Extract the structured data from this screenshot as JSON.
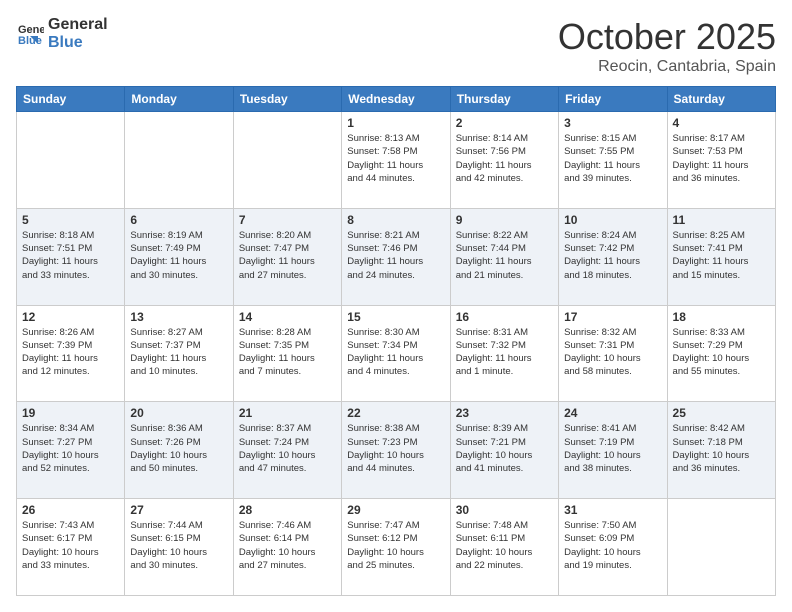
{
  "header": {
    "logo_general": "General",
    "logo_blue": "Blue",
    "month": "October 2025",
    "location": "Reocin, Cantabria, Spain"
  },
  "weekdays": [
    "Sunday",
    "Monday",
    "Tuesday",
    "Wednesday",
    "Thursday",
    "Friday",
    "Saturday"
  ],
  "weeks": [
    [
      {
        "day": "",
        "info": ""
      },
      {
        "day": "",
        "info": ""
      },
      {
        "day": "",
        "info": ""
      },
      {
        "day": "1",
        "info": "Sunrise: 8:13 AM\nSunset: 7:58 PM\nDaylight: 11 hours\nand 44 minutes."
      },
      {
        "day": "2",
        "info": "Sunrise: 8:14 AM\nSunset: 7:56 PM\nDaylight: 11 hours\nand 42 minutes."
      },
      {
        "day": "3",
        "info": "Sunrise: 8:15 AM\nSunset: 7:55 PM\nDaylight: 11 hours\nand 39 minutes."
      },
      {
        "day": "4",
        "info": "Sunrise: 8:17 AM\nSunset: 7:53 PM\nDaylight: 11 hours\nand 36 minutes."
      }
    ],
    [
      {
        "day": "5",
        "info": "Sunrise: 8:18 AM\nSunset: 7:51 PM\nDaylight: 11 hours\nand 33 minutes."
      },
      {
        "day": "6",
        "info": "Sunrise: 8:19 AM\nSunset: 7:49 PM\nDaylight: 11 hours\nand 30 minutes."
      },
      {
        "day": "7",
        "info": "Sunrise: 8:20 AM\nSunset: 7:47 PM\nDaylight: 11 hours\nand 27 minutes."
      },
      {
        "day": "8",
        "info": "Sunrise: 8:21 AM\nSunset: 7:46 PM\nDaylight: 11 hours\nand 24 minutes."
      },
      {
        "day": "9",
        "info": "Sunrise: 8:22 AM\nSunset: 7:44 PM\nDaylight: 11 hours\nand 21 minutes."
      },
      {
        "day": "10",
        "info": "Sunrise: 8:24 AM\nSunset: 7:42 PM\nDaylight: 11 hours\nand 18 minutes."
      },
      {
        "day": "11",
        "info": "Sunrise: 8:25 AM\nSunset: 7:41 PM\nDaylight: 11 hours\nand 15 minutes."
      }
    ],
    [
      {
        "day": "12",
        "info": "Sunrise: 8:26 AM\nSunset: 7:39 PM\nDaylight: 11 hours\nand 12 minutes."
      },
      {
        "day": "13",
        "info": "Sunrise: 8:27 AM\nSunset: 7:37 PM\nDaylight: 11 hours\nand 10 minutes."
      },
      {
        "day": "14",
        "info": "Sunrise: 8:28 AM\nSunset: 7:35 PM\nDaylight: 11 hours\nand 7 minutes."
      },
      {
        "day": "15",
        "info": "Sunrise: 8:30 AM\nSunset: 7:34 PM\nDaylight: 11 hours\nand 4 minutes."
      },
      {
        "day": "16",
        "info": "Sunrise: 8:31 AM\nSunset: 7:32 PM\nDaylight: 11 hours\nand 1 minute."
      },
      {
        "day": "17",
        "info": "Sunrise: 8:32 AM\nSunset: 7:31 PM\nDaylight: 10 hours\nand 58 minutes."
      },
      {
        "day": "18",
        "info": "Sunrise: 8:33 AM\nSunset: 7:29 PM\nDaylight: 10 hours\nand 55 minutes."
      }
    ],
    [
      {
        "day": "19",
        "info": "Sunrise: 8:34 AM\nSunset: 7:27 PM\nDaylight: 10 hours\nand 52 minutes."
      },
      {
        "day": "20",
        "info": "Sunrise: 8:36 AM\nSunset: 7:26 PM\nDaylight: 10 hours\nand 50 minutes."
      },
      {
        "day": "21",
        "info": "Sunrise: 8:37 AM\nSunset: 7:24 PM\nDaylight: 10 hours\nand 47 minutes."
      },
      {
        "day": "22",
        "info": "Sunrise: 8:38 AM\nSunset: 7:23 PM\nDaylight: 10 hours\nand 44 minutes."
      },
      {
        "day": "23",
        "info": "Sunrise: 8:39 AM\nSunset: 7:21 PM\nDaylight: 10 hours\nand 41 minutes."
      },
      {
        "day": "24",
        "info": "Sunrise: 8:41 AM\nSunset: 7:19 PM\nDaylight: 10 hours\nand 38 minutes."
      },
      {
        "day": "25",
        "info": "Sunrise: 8:42 AM\nSunset: 7:18 PM\nDaylight: 10 hours\nand 36 minutes."
      }
    ],
    [
      {
        "day": "26",
        "info": "Sunrise: 7:43 AM\nSunset: 6:17 PM\nDaylight: 10 hours\nand 33 minutes."
      },
      {
        "day": "27",
        "info": "Sunrise: 7:44 AM\nSunset: 6:15 PM\nDaylight: 10 hours\nand 30 minutes."
      },
      {
        "day": "28",
        "info": "Sunrise: 7:46 AM\nSunset: 6:14 PM\nDaylight: 10 hours\nand 27 minutes."
      },
      {
        "day": "29",
        "info": "Sunrise: 7:47 AM\nSunset: 6:12 PM\nDaylight: 10 hours\nand 25 minutes."
      },
      {
        "day": "30",
        "info": "Sunrise: 7:48 AM\nSunset: 6:11 PM\nDaylight: 10 hours\nand 22 minutes."
      },
      {
        "day": "31",
        "info": "Sunrise: 7:50 AM\nSunset: 6:09 PM\nDaylight: 10 hours\nand 19 minutes."
      },
      {
        "day": "",
        "info": ""
      }
    ]
  ]
}
